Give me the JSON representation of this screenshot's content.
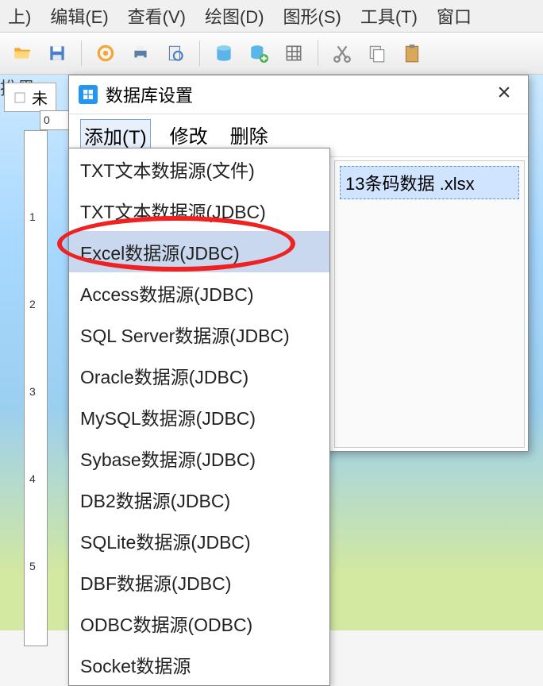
{
  "menubar": {
    "items": [
      "上)",
      "编辑(E)",
      "查看(V)",
      "绘图(D)",
      "图形(S)",
      "工具(T)",
      "窗口"
    ]
  },
  "toolbar": {
    "icons": [
      "folder-open",
      "save",
      "gear",
      "print",
      "print-preview",
      "database",
      "database-add",
      "grid",
      "cut",
      "copy",
      "paste"
    ]
  },
  "document": {
    "tab_label": "未",
    "bg_text": "推黑",
    "ruler_zero": "0"
  },
  "dialog": {
    "title": "数据库设置",
    "menu": {
      "add": "添加(T)",
      "modify": "修改",
      "delete": "删除"
    },
    "file_item": "13条码数据 .xlsx"
  },
  "dropdown": {
    "items": [
      {
        "label": "TXT文本数据源(文件)",
        "highlighted": false
      },
      {
        "label": "TXT文本数据源(JDBC)",
        "highlighted": false
      },
      {
        "label": "Excel数据源(JDBC)",
        "highlighted": true
      },
      {
        "label": "Access数据源(JDBC)",
        "highlighted": false
      },
      {
        "label": "SQL Server数据源(JDBC)",
        "highlighted": false
      },
      {
        "label": "Oracle数据源(JDBC)",
        "highlighted": false
      },
      {
        "label": "MySQL数据源(JDBC)",
        "highlighted": false
      },
      {
        "label": "Sybase数据源(JDBC)",
        "highlighted": false
      },
      {
        "label": "DB2数据源(JDBC)",
        "highlighted": false
      },
      {
        "label": "SQLite数据源(JDBC)",
        "highlighted": false
      },
      {
        "label": "DBF数据源(JDBC)",
        "highlighted": false
      },
      {
        "label": "ODBC数据源(ODBC)",
        "highlighted": false
      },
      {
        "label": "Socket数据源",
        "highlighted": false
      }
    ]
  },
  "ruler_v_ticks": [
    "1",
    "2",
    "3",
    "4",
    "5"
  ]
}
